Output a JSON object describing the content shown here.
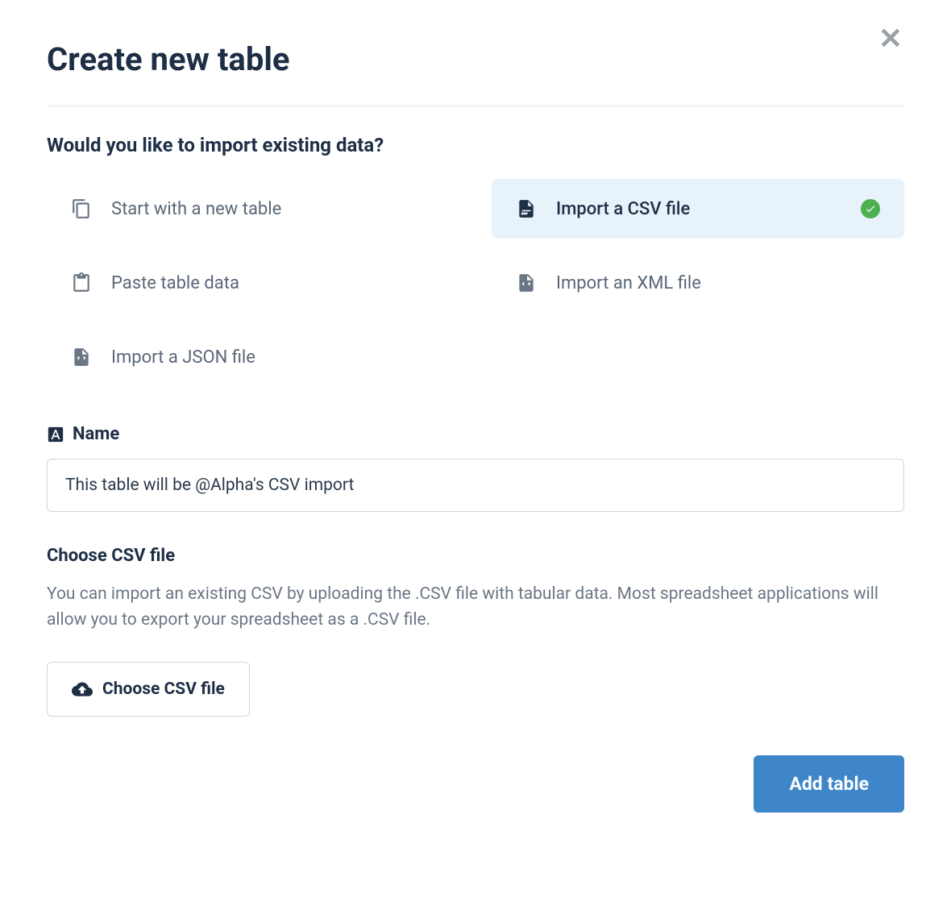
{
  "dialog": {
    "title": "Create new table",
    "close_label": "✕",
    "prompt": "Would you like to import existing data?",
    "options": [
      {
        "icon": "copy-icon",
        "label": "Start with a new table",
        "selected": false
      },
      {
        "icon": "csv-file-icon",
        "label": "Import a CSV file",
        "selected": true
      },
      {
        "icon": "paste-icon",
        "label": "Paste table data",
        "selected": false
      },
      {
        "icon": "xml-file-icon",
        "label": "Import an XML file",
        "selected": false
      },
      {
        "icon": "json-file-icon",
        "label": "Import a JSON file",
        "selected": false
      }
    ],
    "name_field": {
      "label": "Name",
      "value": "This table will be @Alpha's CSV import"
    },
    "csv_section": {
      "label": "Choose CSV file",
      "help": "You can import an existing CSV by uploading the .CSV file with tabular data. Most spreadsheet applications will allow you to export your spreadsheet as a .CSV file.",
      "button_label": "Choose CSV file"
    },
    "submit_label": "Add table"
  },
  "colors": {
    "primary": "#3e86c9",
    "selected_bg": "#e8f2fb",
    "text_dark": "#1e2e45",
    "text_muted": "#6b7684",
    "success": "#4caf50"
  }
}
